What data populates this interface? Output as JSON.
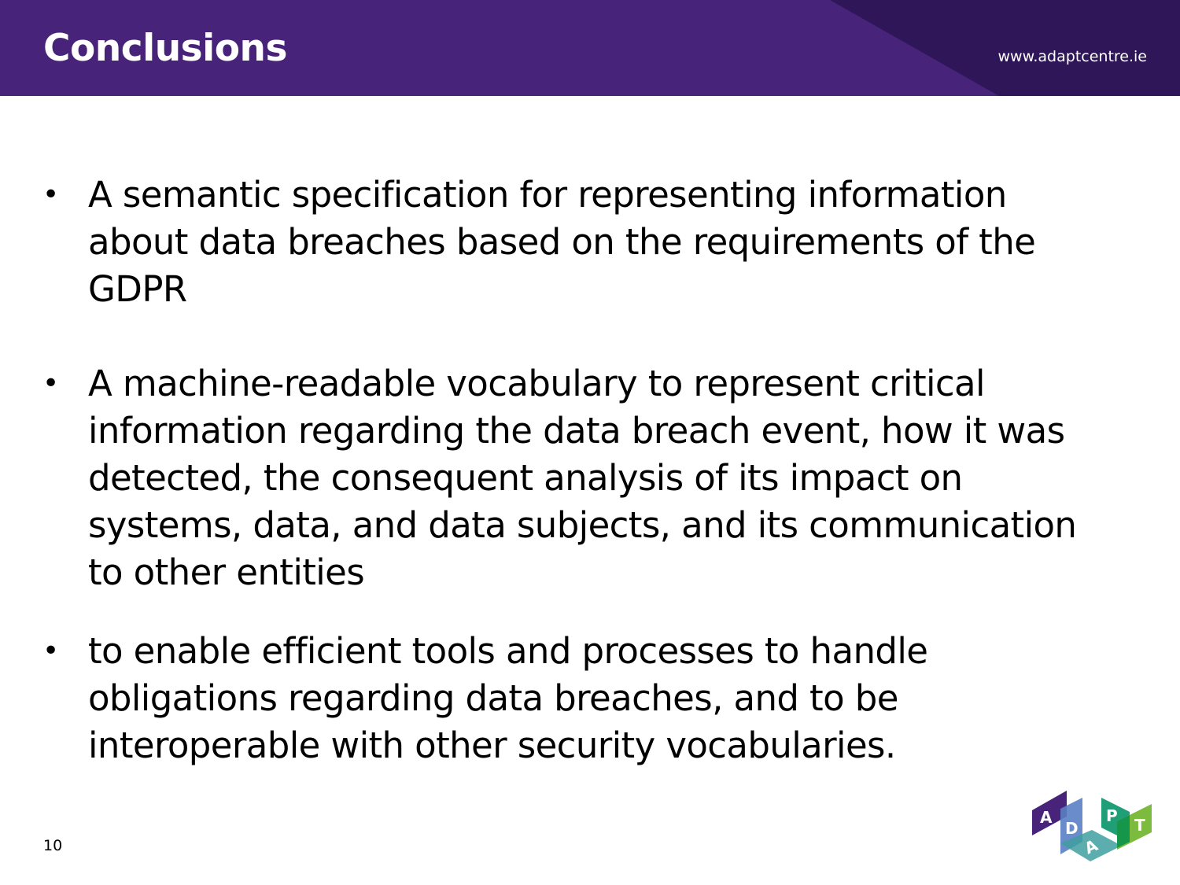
{
  "header": {
    "title": "Conclusions",
    "url": "www.adaptcentre.ie"
  },
  "bullets": [
    {
      "text": "A semantic specification for representing information about data breaches based on the requirements of the GDPR"
    },
    {
      "text": "A machine-readable vocabulary to represent critical information regarding the data breach event, how it was detected, the consequent analysis of its impact on systems, data, and data subjects, and its communication to other entities"
    },
    {
      "text": "to enable efficient tools and processes to handle obligations regarding data breaches, and to be interoperable with other security vocabularies."
    }
  ],
  "bullet_glyph": "•",
  "footer": {
    "page_number": "10"
  },
  "logo": {
    "letters": "ADAPT"
  },
  "colors": {
    "header": "#47237a",
    "header_dark": "#2e1659"
  }
}
